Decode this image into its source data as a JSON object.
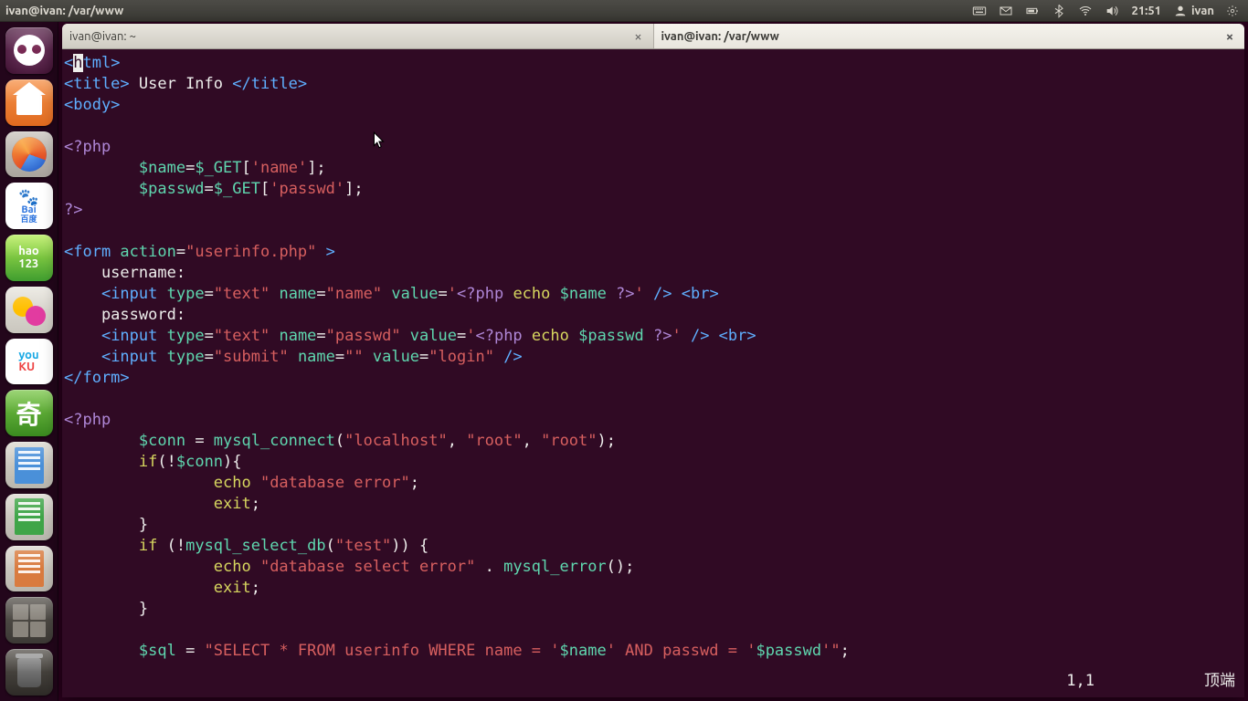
{
  "top_panel": {
    "title": "ivan@ivan: /var/www",
    "clock": "21:51",
    "user": "ivan"
  },
  "launcher": {
    "items": [
      {
        "name": "dash",
        "label": ""
      },
      {
        "name": "files",
        "label": ""
      },
      {
        "name": "firefox",
        "label": ""
      },
      {
        "name": "baidu",
        "label": "Bai",
        "label2": "百度"
      },
      {
        "name": "hao123",
        "label": "hao",
        "label2": "123"
      },
      {
        "name": "qq",
        "label": ""
      },
      {
        "name": "youku",
        "label": "you",
        "label2": "KU"
      },
      {
        "name": "iqiyi",
        "label": "奇"
      },
      {
        "name": "writer",
        "label": ""
      },
      {
        "name": "calc",
        "label": ""
      },
      {
        "name": "impress",
        "label": ""
      },
      {
        "name": "workspaces",
        "label": ""
      },
      {
        "name": "trash",
        "label": ""
      }
    ]
  },
  "tabs": [
    {
      "label": "ivan@ivan: ~",
      "active": false
    },
    {
      "label": "ivan@ivan: /var/www",
      "active": true
    }
  ],
  "code": {
    "l1a": "<",
    "l1b": "h",
    "l1c": "tml>",
    "l2a": "<title>",
    "l2b": " User Info ",
    "l2c": "</title>",
    "l3": "<body>",
    "l5": "<?php",
    "l6a": "        ",
    "l6b": "$name",
    "l6c": "=",
    "l6d": "$_GET",
    "l6e": "[",
    "l6f": "'name'",
    "l6g": "];",
    "l7a": "        ",
    "l7b": "$passwd",
    "l7c": "=",
    "l7d": "$_GET",
    "l7e": "[",
    "l7f": "'passwd'",
    "l7g": "];",
    "l8": "?>",
    "l10a": "<form ",
    "l10b": "action",
    "l10c": "=",
    "l10d": "\"userinfo.php\"",
    "l10e": " >",
    "l11": "    username:",
    "l12a": "    ",
    "l12b": "<input ",
    "l12c": "type",
    "l12d": "=",
    "l12e": "\"text\"",
    "l12f": " name",
    "l12g": "=",
    "l12h": "\"name\"",
    "l12i": " value",
    "l12j": "=",
    "l12k": "'",
    "l12l": "<?php ",
    "l12m": "echo ",
    "l12n": "$name ",
    "l12o": "?>",
    "l12p": "'",
    "l12q": " /> ",
    "l12r": "<br>",
    "l13": "    password:",
    "l14a": "    ",
    "l14b": "<input ",
    "l14c": "type",
    "l14d": "=",
    "l14e": "\"text\"",
    "l14f": " name",
    "l14g": "=",
    "l14h": "\"passwd\"",
    "l14i": " value",
    "l14j": "=",
    "l14k": "'",
    "l14l": "<?php ",
    "l14m": "echo ",
    "l14n": "$passwd ",
    "l14o": "?>",
    "l14p": "'",
    "l14q": " /> ",
    "l14r": "<br>",
    "l15a": "    ",
    "l15b": "<input ",
    "l15c": "type",
    "l15d": "=",
    "l15e": "\"submit\"",
    "l15f": " name",
    "l15g": "=",
    "l15h": "\"\"",
    "l15i": " value",
    "l15j": "=",
    "l15k": "\"login\"",
    "l15l": " />",
    "l16": "</form>",
    "l18": "<?php",
    "l19a": "        ",
    "l19b": "$conn",
    "l19c": " = ",
    "l19d": "mysql_connect",
    "l19e": "(",
    "l19f": "\"localhost\"",
    "l19g": ", ",
    "l19h": "\"root\"",
    "l19i": ", ",
    "l19j": "\"root\"",
    "l19k": ");",
    "l20a": "        ",
    "l20b": "if",
    "l20c": "(!",
    "l20d": "$conn",
    "l20e": "){",
    "l21a": "                ",
    "l21b": "echo ",
    "l21c": "\"database error\"",
    "l21d": ";",
    "l22a": "                ",
    "l22b": "exit",
    "l22c": ";",
    "l23a": "        ",
    "l23b": "}",
    "l24a": "        ",
    "l24b": "if ",
    "l24c": "(!",
    "l24d": "mysql_select_db",
    "l24e": "(",
    "l24f": "\"test\"",
    "l24g": ")) {",
    "l25a": "                ",
    "l25b": "echo ",
    "l25c": "\"database select error\"",
    "l25d": " . ",
    "l25e": "mysql_error",
    "l25f": "();",
    "l26a": "                ",
    "l26b": "exit",
    "l26c": ";",
    "l27a": "        ",
    "l27b": "}",
    "l29a": "        ",
    "l29b": "$sql",
    "l29c": " = ",
    "l29d": "\"SELECT * FROM userinfo WHERE name = '",
    "l29e": "$name",
    "l29f": "' AND passwd = '",
    "l29g": "$passwd",
    "l29h": "'\"",
    "l29i": ";"
  },
  "status": {
    "pos": "1,1",
    "where": "顶端"
  }
}
